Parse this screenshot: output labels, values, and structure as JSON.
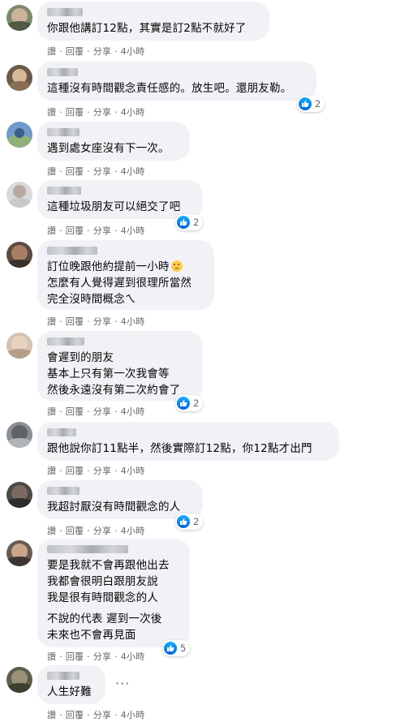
{
  "actions": {
    "like": "讚",
    "reply": "回覆",
    "share": "分享",
    "time": "4小時",
    "sep": "·"
  },
  "colors": {
    "bubble": "#f0f2f5",
    "meta": "#65676b",
    "like_blue": "#1877f2"
  },
  "comments": [
    {
      "lines": [
        "你跟他講訂12點，其實是訂2點不就好了"
      ],
      "likes": ""
    },
    {
      "lines": [
        "這種沒有時間觀念責任感的。放生吧。還朋友勒。"
      ],
      "likes": "2"
    },
    {
      "lines": [
        "遇到處女座沒有下一次。"
      ],
      "likes": ""
    },
    {
      "lines": [
        "這種垃圾朋友可以絕交了吧"
      ],
      "likes": "2"
    },
    {
      "lines": [
        "訂位晚跟他約提前一小時",
        "怎麼有人覺得遲到很理所當然",
        "完全沒時間概念ㄟ"
      ],
      "likes": "",
      "emoji": "thinking-face"
    },
    {
      "lines": [
        "會遲到的朋友",
        "基本上只有第一次我會等",
        "然後永遠沒有第二次約會了"
      ],
      "likes": "2"
    },
    {
      "lines": [
        "跟他說你訂11點半，然後實際訂12點，你12點才出門"
      ],
      "likes": ""
    },
    {
      "lines": [
        "我超討厭沒有時間觀念的人"
      ],
      "likes": "2"
    },
    {
      "lines": [
        "要是我就不會再跟他出去",
        "我都會很明白跟朋友說",
        "我是很有時間觀念的人",
        "",
        "不說的代表 遲到一次後",
        "未來也不會再見面"
      ],
      "likes": "5"
    },
    {
      "lines": [
        "人生好難"
      ],
      "likes": "",
      "more": "···"
    }
  ]
}
